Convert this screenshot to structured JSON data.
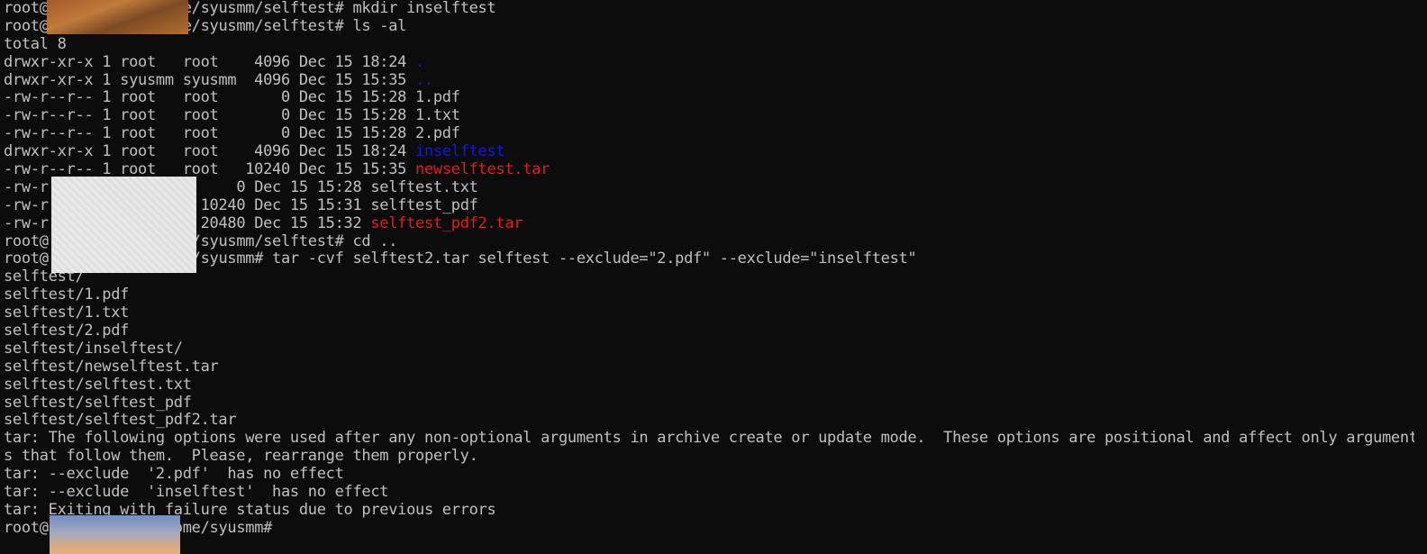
{
  "terminal": {
    "lines": [
      [
        {
          "t": "root@",
          "c": "default"
        },
        {
          "t": "           /home/syusmm/selftest# mkdir inselftest",
          "c": "default"
        }
      ],
      [
        {
          "t": "root@",
          "c": "default"
        },
        {
          "t": "           /home/syusmm/selftest# ls -al",
          "c": "default"
        }
      ],
      [
        {
          "t": "total 8",
          "c": "default"
        }
      ],
      [
        {
          "t": "drwxr-xr-x 1 root   root    4096 Dec 15 18:24 ",
          "c": "default"
        },
        {
          "t": ".",
          "c": "blue"
        }
      ],
      [
        {
          "t": "drwxr-xr-x 1 syusmm syusmm  4096 Dec 15 15:35 ",
          "c": "default"
        },
        {
          "t": "..",
          "c": "blue"
        }
      ],
      [
        {
          "t": "-rw-r--r-- 1 root   root       0 Dec 15 15:28 1.pdf",
          "c": "default"
        }
      ],
      [
        {
          "t": "-rw-r--r-- 1 root   root       0 Dec 15 15:28 1.txt",
          "c": "default"
        }
      ],
      [
        {
          "t": "-rw-r--r-- 1 root   root       0 Dec 15 15:28 2.pdf",
          "c": "default"
        }
      ],
      [
        {
          "t": "drwxr-xr-x 1 root   root    4096 Dec 15 18:24 ",
          "c": "default"
        },
        {
          "t": "inselftest",
          "c": "blue"
        }
      ],
      [
        {
          "t": "-rw-r--r-- 1 root   root   10240 Dec 15 15:35 ",
          "c": "default"
        },
        {
          "t": "newselftest.tar",
          "c": "red"
        }
      ],
      [
        {
          "t": "-rw-r",
          "c": "default"
        },
        {
          "t": "           oot       0 Dec 15 15:28 selftest.txt",
          "c": "default"
        }
      ],
      [
        {
          "t": "-rw-r",
          "c": "default"
        },
        {
          "t": "           oot   10240 Dec 15 15:31 selftest_pdf",
          "c": "default"
        }
      ],
      [
        {
          "t": "-rw-r",
          "c": "default"
        },
        {
          "t": "           oot   20480 Dec 15 15:32 ",
          "c": "default"
        },
        {
          "t": "selftest_pdf2.tar",
          "c": "red"
        }
      ],
      [
        {
          "t": "root@",
          "c": "default"
        },
        {
          "t": "           /home/syusmm/selftest# cd ..",
          "c": "default"
        }
      ],
      [
        {
          "t": "root@",
          "c": "default"
        },
        {
          "t": "           /home/syusmm# tar -cvf selftest2.tar selftest --exclude=\"2.pdf\" --exclude=\"inselftest\"",
          "c": "default"
        }
      ],
      [
        {
          "t": "selftest/",
          "c": "default"
        }
      ],
      [
        {
          "t": "selftest/1.pdf",
          "c": "default"
        }
      ],
      [
        {
          "t": "selftest/1.txt",
          "c": "default"
        }
      ],
      [
        {
          "t": "selftest/2.pdf",
          "c": "default"
        }
      ],
      [
        {
          "t": "selftest/inselftest/",
          "c": "default"
        }
      ],
      [
        {
          "t": "selftest/newselftest.tar",
          "c": "default"
        }
      ],
      [
        {
          "t": "selftest/selftest.txt",
          "c": "default"
        }
      ],
      [
        {
          "t": "selftest/selftest_pdf",
          "c": "default"
        }
      ],
      [
        {
          "t": "selftest/selftest_pdf2.tar",
          "c": "default"
        }
      ],
      [
        {
          "t": "tar: The following options were used after any non-optional arguments in archive create or update mode.  These options are positional and affect only argument",
          "c": "default"
        }
      ],
      [
        {
          "t": "s that follow them.  Please, rearrange them properly.",
          "c": "default"
        }
      ],
      [
        {
          "t": "tar: --exclude  '2.pdf'  has no effect",
          "c": "default"
        }
      ],
      [
        {
          "t": "tar: --exclude  'inselftest'  has no effect",
          "c": "default"
        }
      ],
      [
        {
          "t": "tar: Exiting with failure status due to previous errors",
          "c": "default"
        }
      ],
      [
        {
          "t": "root@",
          "c": "default"
        },
        {
          "t": "           :/home/syusmm#",
          "c": "default"
        }
      ]
    ],
    "colors": {
      "background": "#0c0c0c",
      "default": "#c0c0c0",
      "blue": "#1515e8",
      "red": "#e21c1c"
    }
  }
}
